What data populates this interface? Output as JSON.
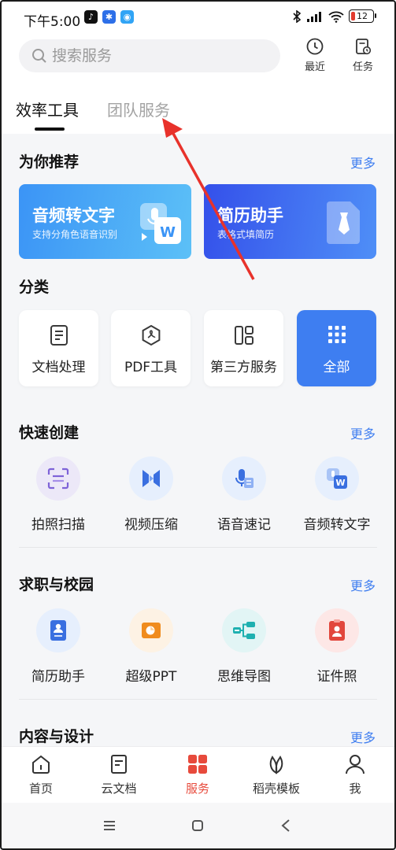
{
  "status_bar": {
    "time": "下午5:00",
    "battery": "12"
  },
  "header": {
    "search_placeholder": "搜索服务",
    "recent_label": "最近",
    "tasks_label": "任务"
  },
  "tabs": [
    {
      "label": "效率工具",
      "active": true
    },
    {
      "label": "团队服务",
      "active": false
    }
  ],
  "recommend": {
    "title": "为你推荐",
    "more": "更多",
    "cards": [
      {
        "title": "音频转文字",
        "subtitle": "支持分角色语音识别",
        "color": "#3b9cf5"
      },
      {
        "title": "简历助手",
        "subtitle": "表格式填简历",
        "color": "#3a62ef"
      }
    ]
  },
  "categories": {
    "title": "分类",
    "items": [
      {
        "label": "文档处理",
        "icon": "document-icon"
      },
      {
        "label": "PDF工具",
        "icon": "pdf-icon"
      },
      {
        "label": "第三方服务",
        "icon": "layout-icon"
      },
      {
        "label": "全部",
        "icon": "grid-icon"
      }
    ]
  },
  "quick_create": {
    "title": "快速创建",
    "more": "更多",
    "items": [
      {
        "label": "拍照扫描",
        "icon": "scan-icon"
      },
      {
        "label": "视频压缩",
        "icon": "video-compress-icon"
      },
      {
        "label": "语音速记",
        "icon": "voice-note-icon"
      },
      {
        "label": "音频转文字",
        "icon": "audio-to-text-icon"
      }
    ]
  },
  "career": {
    "title": "求职与校园",
    "more": "更多",
    "items": [
      {
        "label": "简历助手",
        "icon": "resume-icon"
      },
      {
        "label": "超级PPT",
        "icon": "ppt-icon"
      },
      {
        "label": "思维导图",
        "icon": "mindmap-icon"
      },
      {
        "label": "证件照",
        "icon": "id-photo-icon"
      }
    ]
  },
  "content_design": {
    "title": "内容与设计",
    "more": "更多"
  },
  "bottom_nav": [
    {
      "label": "首页",
      "icon": "home-icon"
    },
    {
      "label": "云文档",
      "icon": "cloud-doc-icon"
    },
    {
      "label": "服务",
      "icon": "services-icon",
      "active": true
    },
    {
      "label": "稻壳模板",
      "icon": "template-icon"
    },
    {
      "label": "我",
      "icon": "profile-icon"
    }
  ],
  "colors": {
    "accent": "#3f7ef0",
    "nav_active": "#e74a3c",
    "annotation_arrow": "#e8322b"
  }
}
